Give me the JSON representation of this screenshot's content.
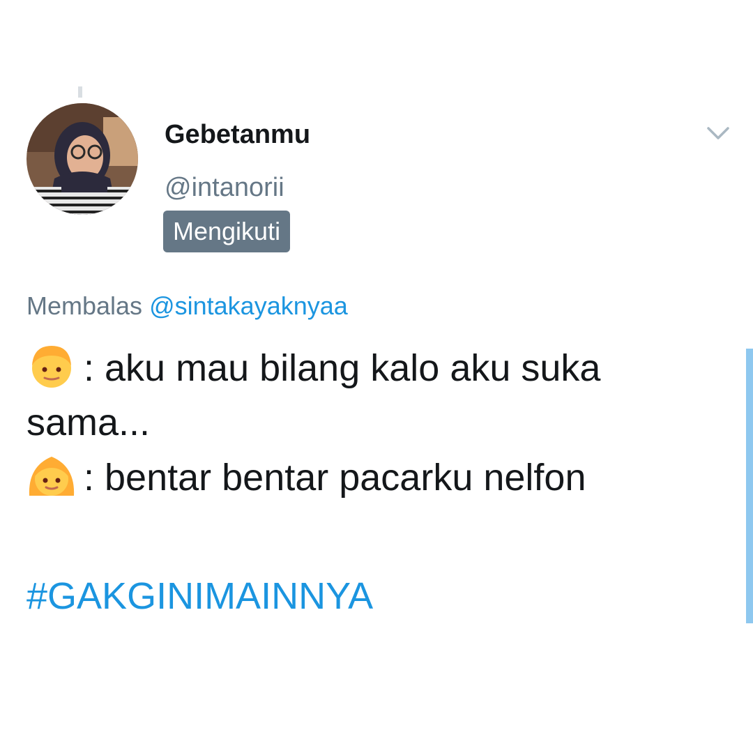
{
  "tweet": {
    "author": {
      "display_name": "Gebetanmu",
      "username": "@intanorii",
      "follows_badge": "Mengikuti"
    },
    "reply": {
      "prefix": "Membalas",
      "mention": "@sintakayaknyaa"
    },
    "lines": [
      {
        "emoji": "boy-emoji-icon",
        "text": ": aku mau bilang kalo aku suka"
      },
      {
        "emoji": null,
        "text": "sama..."
      },
      {
        "emoji": "girl-emoji-icon",
        "text": ": bentar bentar pacarku nelfon"
      }
    ],
    "hashtag": "#GAKGINIMAINNYA"
  },
  "icons": {
    "menu": "chevron-down-icon"
  },
  "colors": {
    "text": "#14171a",
    "secondary": "#657786",
    "link": "#1b95e0",
    "badge_bg": "#657786",
    "scrollbar": "#8ec8ef"
  }
}
